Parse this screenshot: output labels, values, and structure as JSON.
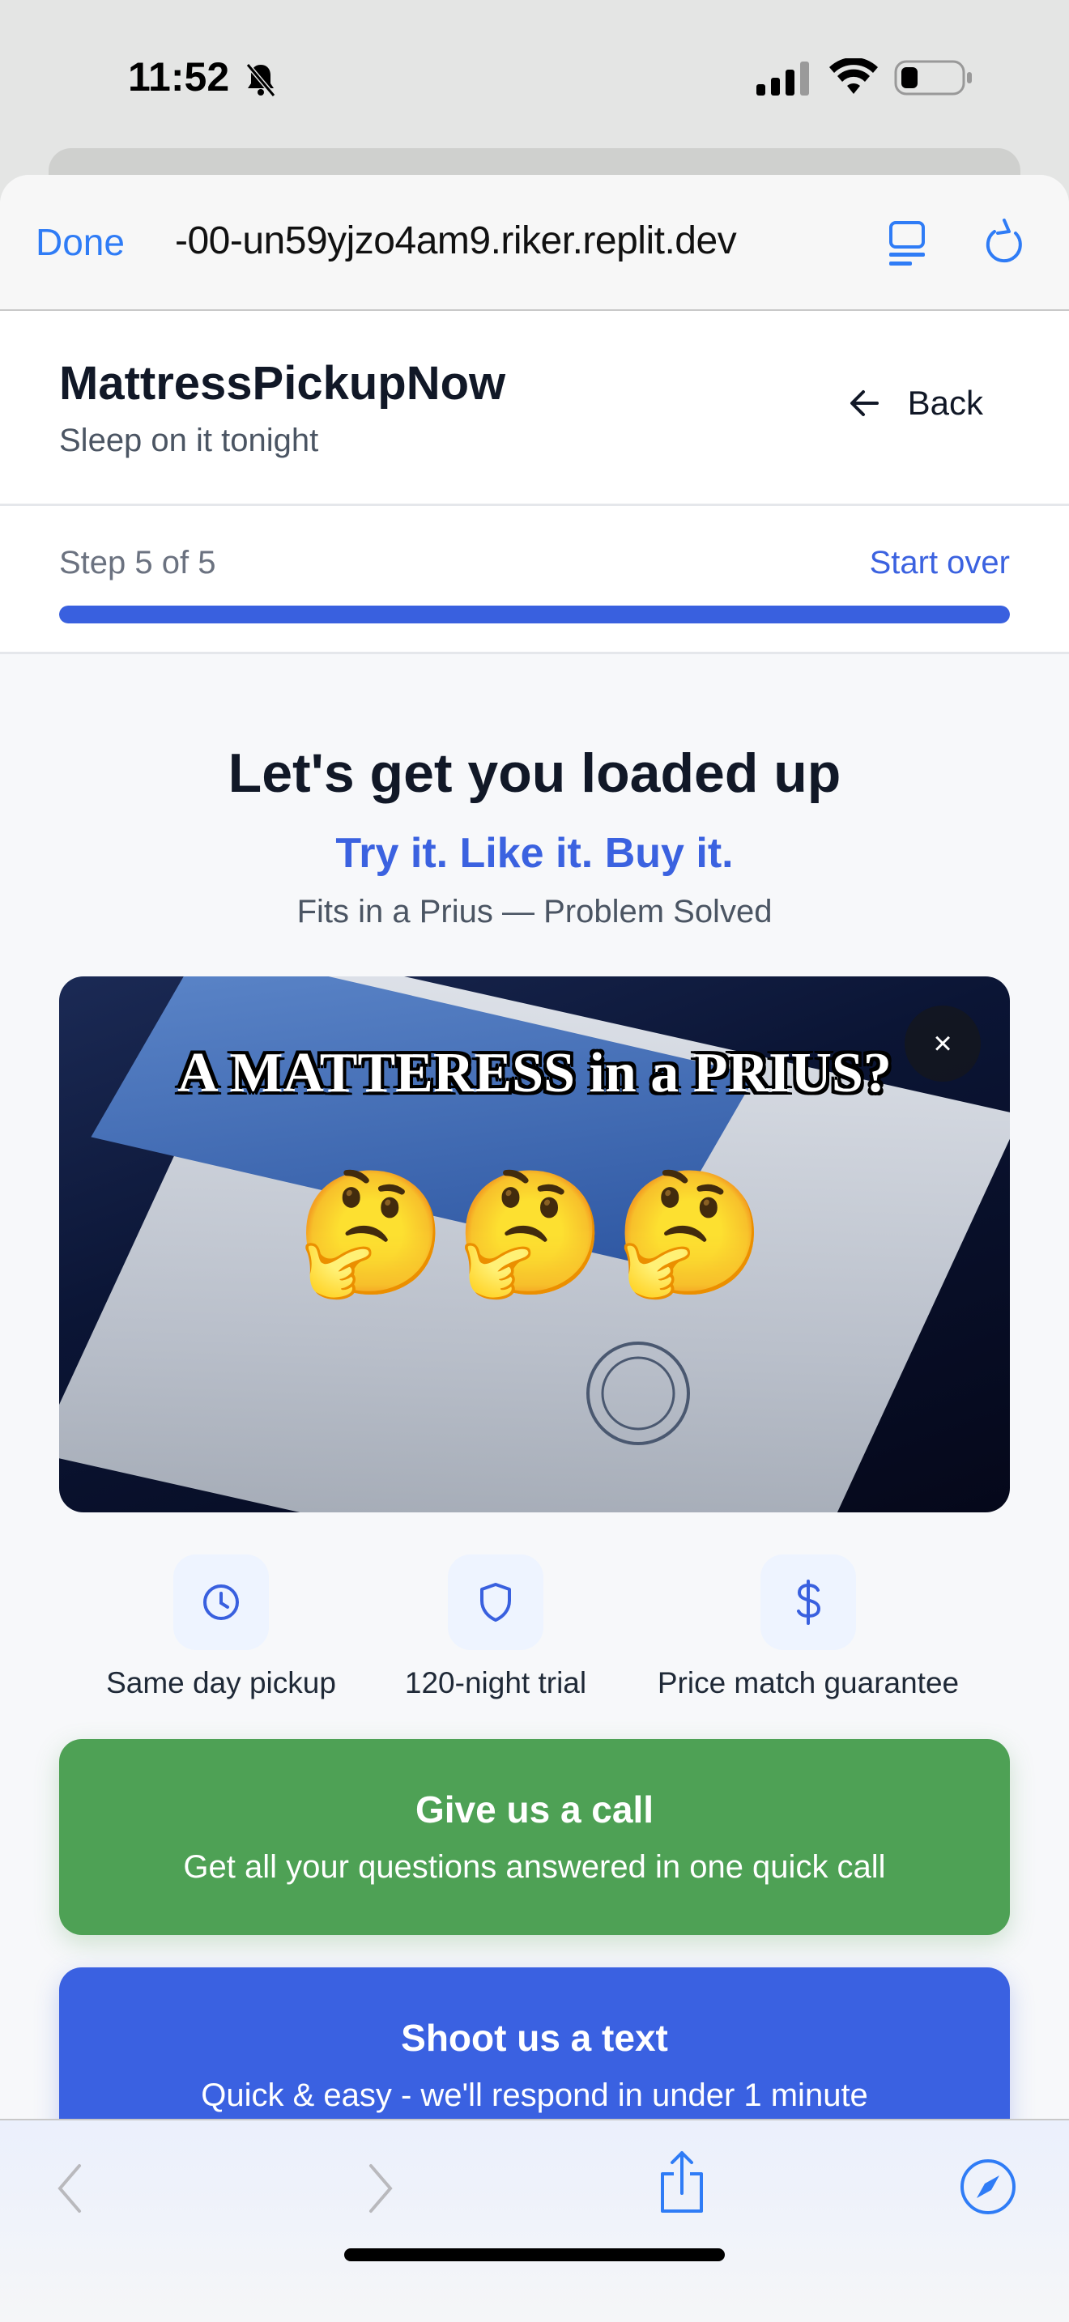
{
  "status_bar": {
    "time": "11:52"
  },
  "browser": {
    "done_label": "Done",
    "url": "-00-un59yjzo4am9.riker.replit.dev"
  },
  "header": {
    "title": "MattressPickupNow",
    "subtitle": "Sleep on it tonight",
    "back_label": "Back"
  },
  "progress": {
    "step_text": "Step 5 of 5",
    "start_over": "Start over",
    "percent": 100
  },
  "hero": {
    "headline": "Let's get you loaded up",
    "tagline": "Try it. Like it. Buy it.",
    "subtext": "Fits in a Prius — Problem Solved"
  },
  "video": {
    "caption": "A MATTERESS in a PRIUS?",
    "emojis": "🤔🤔🤔",
    "close": "×"
  },
  "features": [
    {
      "label": "Same day pickup",
      "icon": "clock-icon"
    },
    {
      "label": "120-night trial",
      "icon": "shield-icon"
    },
    {
      "label": "Price match guarantee",
      "icon": "dollar-icon"
    }
  ],
  "cta": {
    "call_title": "Give us a call",
    "call_sub": "Get all your questions answered in one quick call",
    "text_title": "Shoot us a text",
    "text_sub": "Quick & easy - we'll respond in under 1 minute"
  },
  "colors": {
    "accent": "#3960df",
    "green": "#4ea155",
    "safari_blue": "#2f7cf6"
  }
}
